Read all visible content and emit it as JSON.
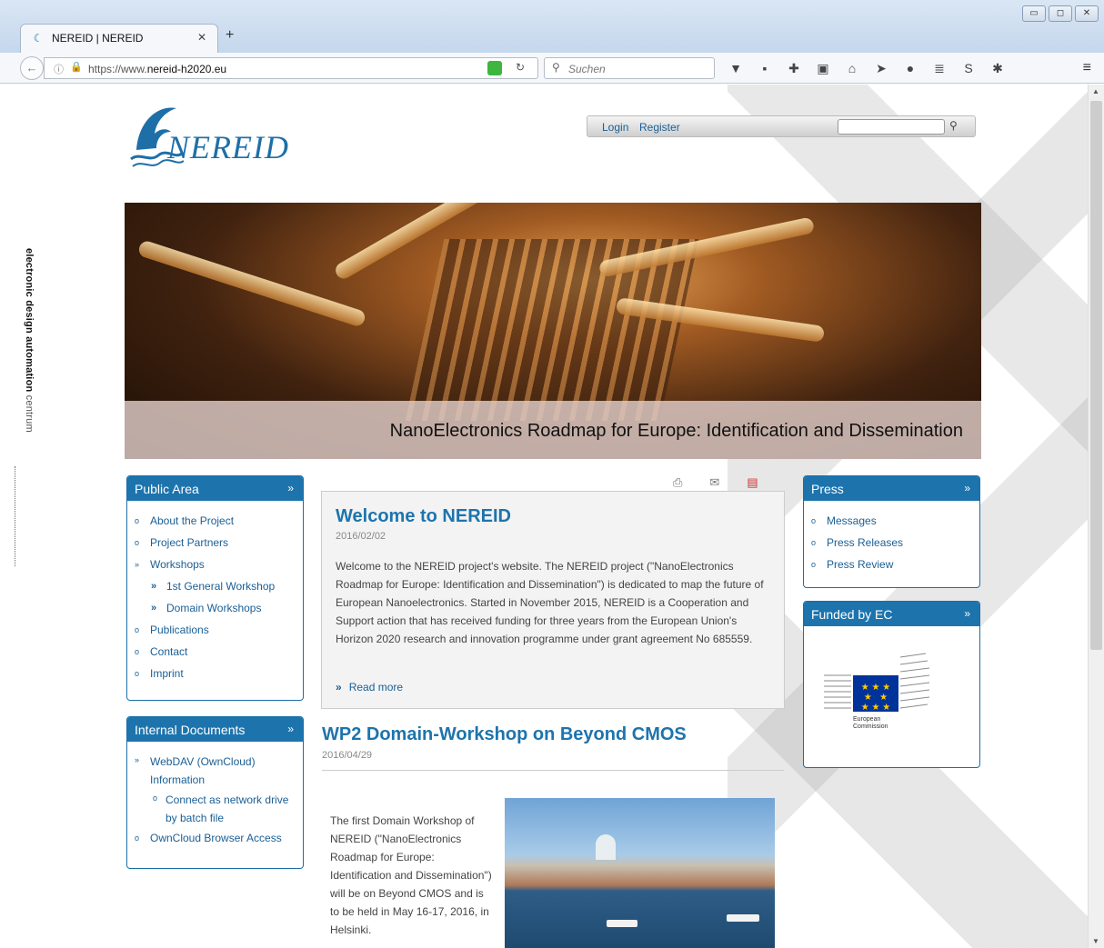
{
  "browser": {
    "tab_title": "NEREID | NEREID",
    "url_prefix": "https://www.",
    "url_domain": "nereid-h2020.eu",
    "search_placeholder": "Suchen"
  },
  "page": {
    "side_label_bold": "electronic design automation",
    "side_label_light": "centrum",
    "logo_text": "NEREID",
    "topbar": {
      "login": "Login",
      "register": "Register"
    },
    "hero_caption": "NanoElectronics Roadmap for Europe: Identification and Dissemination"
  },
  "public_area": {
    "title": "Public Area",
    "items": [
      {
        "label": "About the Project",
        "bullet": "o"
      },
      {
        "label": "Project Partners",
        "bullet": "o"
      },
      {
        "label": "Workshops",
        "bullet": "»"
      },
      {
        "label": "1st General Workshop",
        "bullet": "»"
      },
      {
        "label": "Domain Workshops",
        "bullet": "»"
      },
      {
        "label": "Publications",
        "bullet": "o"
      },
      {
        "label": "Contact",
        "bullet": "o"
      },
      {
        "label": "Imprint",
        "bullet": "o"
      }
    ]
  },
  "internal_docs": {
    "title": "Internal Documents",
    "items": [
      {
        "label": "WebDAV (OwnCloud) Information",
        "bullet": "»"
      },
      {
        "label": "Connect as network drive by batch file",
        "bullet": "o"
      },
      {
        "label": "OwnCloud Browser Access",
        "bullet": "o"
      }
    ]
  },
  "press": {
    "title": "Press",
    "items": [
      {
        "label": "Messages",
        "bullet": "o"
      },
      {
        "label": "Press Releases",
        "bullet": "o"
      },
      {
        "label": "Press Review",
        "bullet": "o"
      }
    ]
  },
  "funded": {
    "title": "Funded by EC",
    "logo_line1": "European",
    "logo_line2": "Commission"
  },
  "article1": {
    "title": "Welcome to NEREID",
    "date": "2016/02/02",
    "body": "Welcome to the NEREID project's website. The NEREID project (\"NanoElectronics Roadmap for Europe: Identification and Dissemination\") is dedicated to map the future of European Nanoelectronics. Started in November 2015, NEREID is a Cooperation and Support action that has received funding for three years from the European Union's Horizon 2020 research and innovation programme under grant agreement No 685559.",
    "read_more": "Read more"
  },
  "article2": {
    "title": "WP2 Domain-Workshop on Beyond CMOS",
    "date": "2016/04/29",
    "body": "The first Domain Workshop of NEREID (\"NanoElectronics Roadmap for Europe: Identification and Dissemination\") will be on Beyond CMOS and is to be held in May 16-17, 2016, in Helsinki."
  },
  "colors": {
    "accent": "#1d74ad",
    "link": "#1a5f95"
  }
}
